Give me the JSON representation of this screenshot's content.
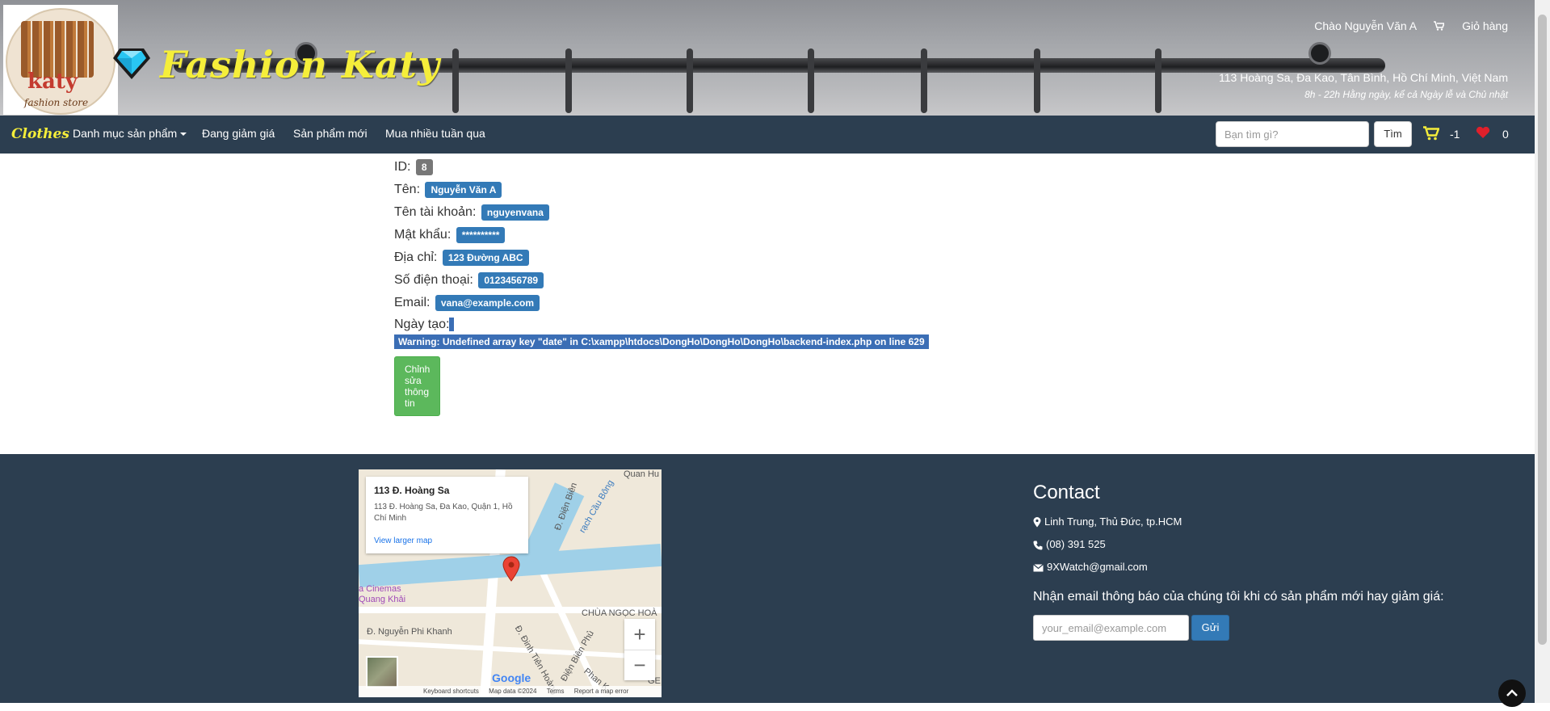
{
  "header": {
    "logo_text": "katy",
    "logo_subtext": "fashion store",
    "brand": "Fashion Katy",
    "greeting": "Chào Nguyễn Văn A",
    "cart_link": "Giỏ hàng",
    "address": "113 Hoàng Sa, Đa Kao, Tân Bình, Hồ Chí Minh, Việt Nam",
    "hours": "8h - 22h Hằng ngày, kể cả Ngày lễ và Chủ nhật"
  },
  "nav": {
    "brand": "Clothes",
    "items": [
      "Danh mục sản phẩm",
      "Đang giảm giá",
      "Sản phẩm mới",
      "Mua nhiều tuần qua"
    ],
    "search_placeholder": "Bạn tìm gì?",
    "search_button": "Tìm",
    "cart_count": "-1",
    "wishlist_count": "0"
  },
  "profile": {
    "fields": [
      {
        "label": "ID:",
        "value": "8"
      },
      {
        "label": "Tên:",
        "value": "Nguyễn Văn A"
      },
      {
        "label": "Tên tài khoản:",
        "value": "nguyenvana"
      },
      {
        "label": "Mật khẩu:",
        "value": "**********"
      },
      {
        "label": "Địa chỉ:",
        "value": "123 Đường ABC"
      },
      {
        "label": "Số điện thoại:",
        "value": "0123456789"
      },
      {
        "label": "Email:",
        "value": "vana@example.com"
      },
      {
        "label": "Ngày tạo:",
        "value": ""
      }
    ],
    "warning": "Warning: Undefined array key \"date\" in C:\\xampp\\htdocs\\DongHo\\DongHo\\DongHo\\backend-index.php on line 629",
    "edit_button": "Chỉnh sửa thông tin"
  },
  "map": {
    "place_title": "113 Đ. Hoàng Sa",
    "place_address": "113 Đ. Hoàng Sa, Đa Kao, Quận 1, Hồ Chí Minh",
    "larger_map": "View larger map",
    "labels": [
      "Quan Hu",
      "Đ. Điện Biên",
      "rạch Cầu Bông",
      "a Cinemas Quang Khải",
      "Đ. Nguyễn Phi Khanh",
      "CHÙA NGỌC HOÀ",
      "Đ. Đinh Tiên Hoàng",
      "Điện Biên Phủ",
      "Phan K",
      "GE"
    ],
    "google": "Google",
    "footer": [
      "Keyboard shortcuts",
      "Map data ©2024",
      "Terms",
      "Report a map error"
    ]
  },
  "contact": {
    "title": "Contact",
    "address": "Linh Trung, Thủ Đức, tp.HCM",
    "phone": "(08) 391 525",
    "email": "9XWatch@gmail.com",
    "newsletter_text": "Nhận email thông báo của chúng tôi khi có sản phẩm mới hay giảm giá:",
    "email_placeholder": "your_email@example.com",
    "send_button": "Gửi"
  },
  "colors": {
    "navbar": "#2c3e50",
    "brand_yellow": "#f5ee3a",
    "badge_blue": "#337ab7",
    "button_green": "#5cb85c"
  }
}
